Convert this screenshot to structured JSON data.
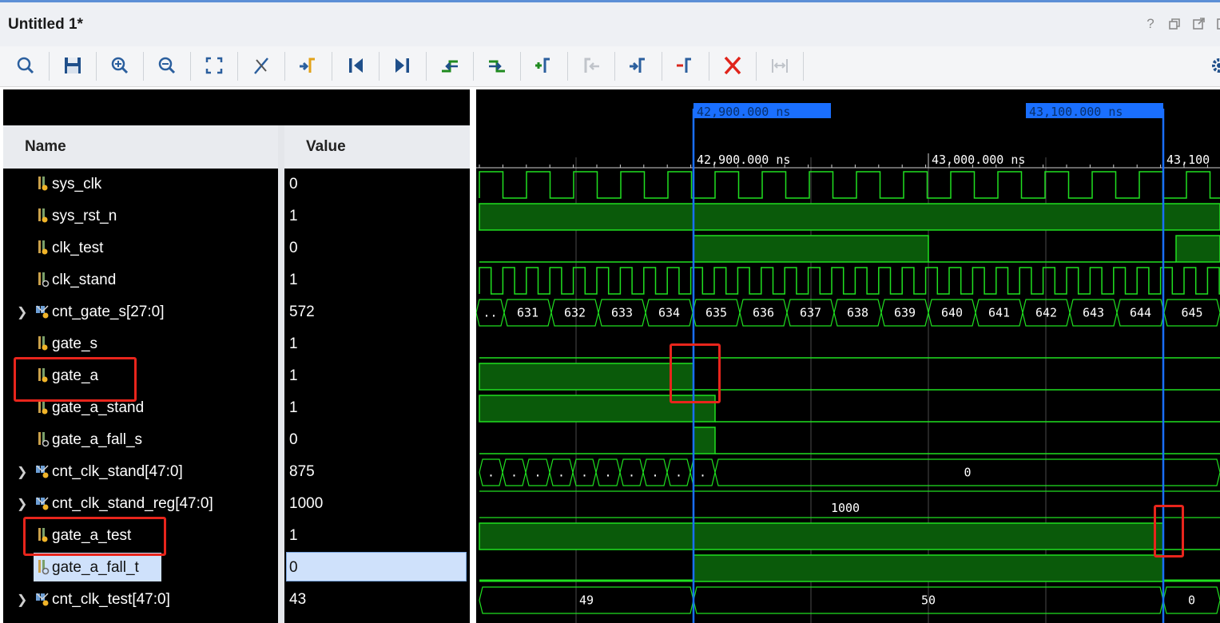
{
  "window": {
    "title": "Untitled 1*",
    "controls": [
      "help-icon",
      "restore-icon",
      "maximize-icon",
      "close-icon"
    ],
    "help_label": "?"
  },
  "toolbar": {
    "buttons": [
      "search-icon",
      "save-icon",
      "zoom-in-icon",
      "zoom-out-icon",
      "zoom-fit-icon",
      "cursor-snap-icon",
      "go-to-cursor-icon",
      "go-to-start-icon",
      "go-to-end-icon",
      "previous-transition-icon",
      "next-transition-icon",
      "add-marker-icon",
      "previous-marker-icon",
      "next-marker-icon",
      "delete-marker-icon",
      "delete-all-markers-icon",
      "swap-cursors-icon",
      "settings-icon"
    ]
  },
  "columns": {
    "name": "Name",
    "value": "Value"
  },
  "signals": [
    {
      "name": "sys_clk",
      "value": "0",
      "expandable": false,
      "icon": "signal-out-icon"
    },
    {
      "name": "sys_rst_n",
      "value": "1",
      "expandable": false,
      "icon": "signal-out-icon"
    },
    {
      "name": "clk_test",
      "value": "0",
      "expandable": false,
      "icon": "signal-out-icon"
    },
    {
      "name": "clk_stand",
      "value": "1",
      "expandable": false,
      "icon": "signal-in-icon"
    },
    {
      "name": "cnt_gate_s[27:0]",
      "value": "572",
      "expandable": true,
      "icon": "bus-icon"
    },
    {
      "name": "gate_s",
      "value": "1",
      "expandable": false,
      "icon": "signal-out-icon"
    },
    {
      "name": "gate_a",
      "value": "1",
      "expandable": false,
      "icon": "signal-out-icon"
    },
    {
      "name": "gate_a_stand",
      "value": "1",
      "expandable": false,
      "icon": "signal-out-icon"
    },
    {
      "name": "gate_a_fall_s",
      "value": "0",
      "expandable": false,
      "icon": "signal-in-icon"
    },
    {
      "name": "cnt_clk_stand[47:0]",
      "value": "875",
      "expandable": true,
      "icon": "bus-icon"
    },
    {
      "name": "cnt_clk_stand_reg[47:0]",
      "value": "1000",
      "expandable": true,
      "icon": "bus-icon"
    },
    {
      "name": "gate_a_test",
      "value": "1",
      "expandable": false,
      "icon": "signal-out-icon"
    },
    {
      "name": "gate_a_fall_t",
      "value": "0",
      "expandable": false,
      "icon": "signal-in-icon",
      "selected": true
    },
    {
      "name": "cnt_clk_test[47:0]",
      "value": "43",
      "expandable": true,
      "icon": "bus-icon"
    }
  ],
  "waveform": {
    "markers": [
      {
        "label": "42,900.000 ns"
      },
      {
        "label": "43,100.000 ns"
      }
    ],
    "ruler_ticks": [
      "42,900.000 ns",
      "43,000.000 ns",
      "43,100"
    ],
    "cnt_gate_s_values": [
      "..",
      "631",
      "632",
      "633",
      "634",
      "635",
      "636",
      "637",
      "638",
      "639",
      "640",
      "641",
      "642",
      "643",
      "644",
      "645"
    ],
    "cnt_clk_stand_values": [
      ".",
      ".",
      ".",
      ".",
      ".",
      ".",
      ".",
      ".",
      ".",
      ".",
      "0"
    ],
    "cnt_clk_stand_reg_value": "1000",
    "cnt_clk_test_values": [
      "49",
      "50",
      "0"
    ]
  },
  "colors": {
    "wave": "#20e020",
    "wave_fill": "#0a5a0a",
    "marker": "#1a6fff",
    "highlight": "#e8251c",
    "grid": "#3a3a3a"
  }
}
